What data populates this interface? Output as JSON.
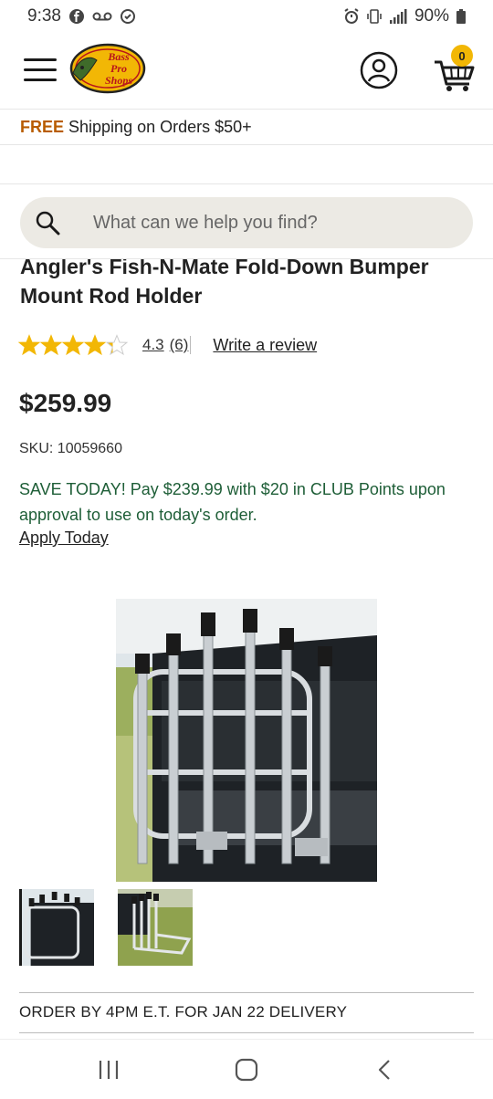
{
  "status_bar": {
    "time": "9:38",
    "battery": "90%",
    "left_icons": [
      "facebook-icon",
      "voicemail-icon",
      "sync-icon"
    ],
    "right_icons": [
      "alarm-icon",
      "vibrate-icon",
      "signal-icon",
      "battery-icon"
    ]
  },
  "header": {
    "logo_text": "Bass Pro Shops",
    "cart_count": "0"
  },
  "promo": {
    "free_label": "FREE",
    "text": "Shipping on Orders $50+"
  },
  "search": {
    "placeholder": "What can we help you find?"
  },
  "product": {
    "title": "Angler's Fish-N-Mate Fold-Down Bumper Mount Rod Holder",
    "rating": 4.3,
    "rating_text": "4.3",
    "review_count": "(6)",
    "write_review": "Write a review",
    "price": "$259.99",
    "sku": "SKU: 10059660",
    "save_offer": "SAVE TODAY! Pay $239.99 with $20 in CLUB Points upon approval to use on today's order.",
    "apply_link": "Apply Today",
    "thumbnail_count": 2
  },
  "delivery": {
    "order_by": "ORDER BY 4PM E.T. FOR JAN 22 DELIVERY"
  },
  "colors": {
    "promo_free": "#b85c00",
    "save_green": "#1e5e37",
    "star_gold": "#f2b705",
    "badge_yellow": "#f2b705",
    "search_bg": "#eceae4"
  }
}
